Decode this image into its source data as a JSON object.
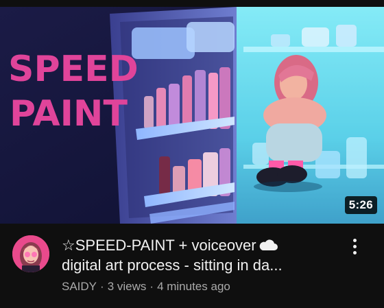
{
  "video": {
    "thumbnail_text_line1": "SPEED",
    "thumbnail_text_line2": "PAINT",
    "duration": "5:26",
    "title_line1": "☆SPEED-PAINT + voiceover",
    "title_cloud_icon": "cloud-icon",
    "title_line2": "digital art process - sitting in da...",
    "channel": "SAIDY",
    "views": "3 views",
    "uploaded": "4 minutes ago",
    "separator": "·"
  },
  "colors": {
    "background": "#0f0f0f",
    "title_text": "#f1f1f1",
    "secondary_text": "#aaaaaa",
    "thumbnail_text": "#e0449a",
    "fridge_light": "#5fe3f0"
  },
  "icons": {
    "menu": "more-vert-icon",
    "avatar": "channel-avatar"
  }
}
